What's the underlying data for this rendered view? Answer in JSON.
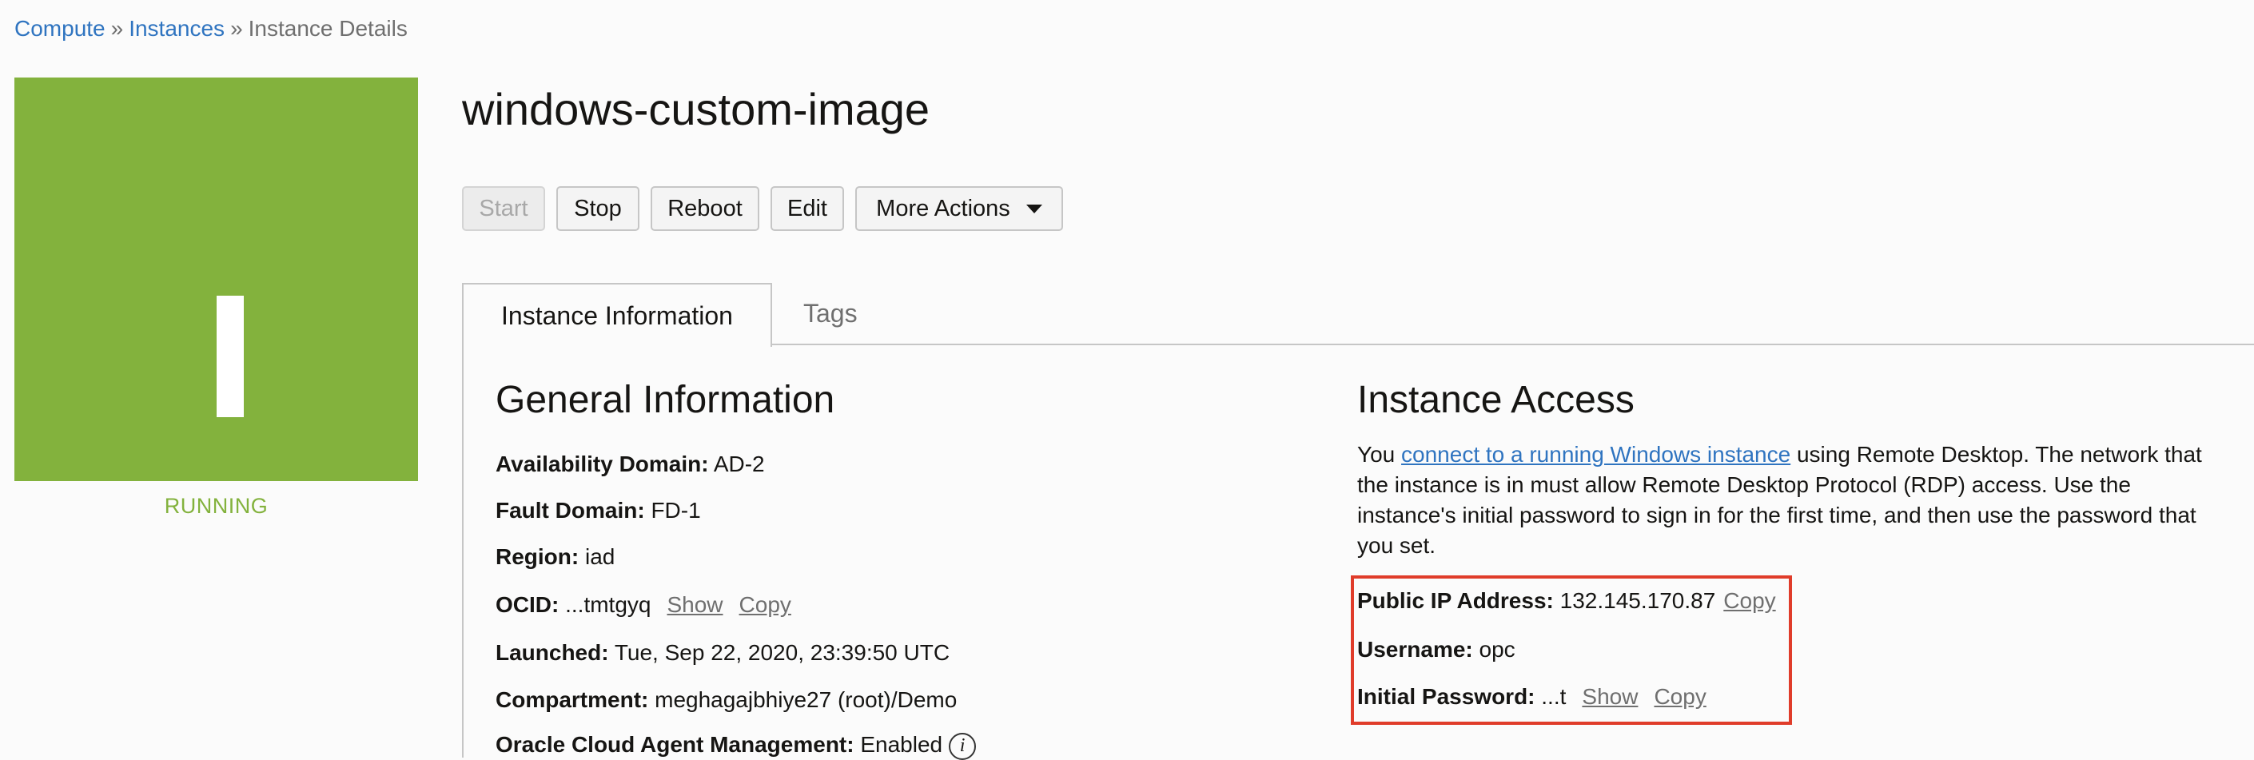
{
  "breadcrumb": {
    "compute": "Compute",
    "instances": "Instances",
    "current": "Instance Details",
    "separator": "»"
  },
  "instance": {
    "tile_letter": "I",
    "status": "RUNNING",
    "status_color": "#83b23d",
    "name": "windows-custom-image"
  },
  "actions": {
    "start": "Start",
    "stop": "Stop",
    "reboot": "Reboot",
    "edit": "Edit",
    "more": "More Actions"
  },
  "tabs": {
    "info": "Instance Information",
    "tags": "Tags"
  },
  "general": {
    "heading": "General Information",
    "fields": [
      {
        "label": "Availability Domain:",
        "value": "AD-2"
      },
      {
        "label": "Fault Domain:",
        "value": "FD-1"
      },
      {
        "label": "Region:",
        "value": "iad"
      },
      {
        "label": "OCID:",
        "value": "...tmtgyq",
        "show": "Show",
        "copy": "Copy"
      },
      {
        "label": "Launched:",
        "value": "Tue, Sep 22, 2020, 23:39:50 UTC"
      },
      {
        "label": "Compartment:",
        "value": "meghagajbhiye27 (root)/Demo"
      },
      {
        "label": "Oracle Cloud Agent Management:",
        "value": "Enabled",
        "icon": "info-icon"
      }
    ]
  },
  "access": {
    "heading": "Instance Access",
    "intro_prefix": "You ",
    "intro_link": "connect to a running Windows instance",
    "intro_suffix": " using Remote Desktop. The network that the instance is in must allow Remote Desktop Protocol (RDP) access. Use the instance's initial password to sign in for the first time, and then use the password that you set.",
    "public_ip_label": "Public IP Address:",
    "public_ip": "132.145.170.87",
    "copy": "Copy",
    "username_label": "Username:",
    "username": "opc",
    "password_label": "Initial Password:",
    "password": "...t",
    "show": "Show",
    "highlight_color": "#e03c2a"
  },
  "colors": {
    "link": "#2f74c0",
    "accent_green": "#83b23d"
  }
}
